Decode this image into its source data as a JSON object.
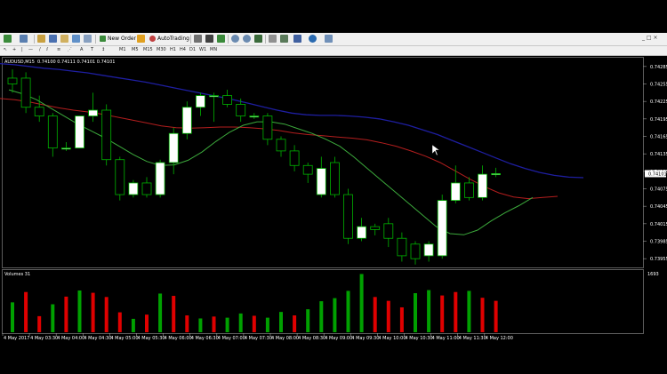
{
  "toolbar": {
    "new_order_label": "New Order",
    "autotrading_label": "AutoTrading",
    "timeframes": [
      "M1",
      "M5",
      "M15",
      "M30",
      "H1",
      "H4",
      "D1",
      "W1",
      "MN"
    ],
    "window_controls": "_ □ ×"
  },
  "chart_data": {
    "type": "candlestick",
    "symbol_label": "AUDUSD,M15",
    "ohlc_label": "0.74100 0.74111 0.74101 0.74101",
    "volume_label": "Volumes 31",
    "volume_top_label": "1693",
    "price_ticks": [
      "0.74285",
      "0.74255",
      "0.74225",
      "0.74195",
      "0.74165",
      "0.74135",
      "0.74105",
      "0.74075",
      "0.74045",
      "0.74015",
      "0.73985",
      "0.73955"
    ],
    "current_price": "0.74101",
    "ylim": [
      0.7394,
      0.743
    ],
    "time_labels": [
      "4 May 2017",
      "4 May 03:30",
      "4 May 04:00",
      "4 May 04:30",
      "4 May 05:00",
      "4 May 05:30",
      "4 May 06:00",
      "4 May 06:30",
      "4 May 07:00",
      "4 May 07:30",
      "4 May 08:00",
      "4 May 08:30",
      "4 May 09:00",
      "4 May 09:30",
      "4 May 10:00",
      "4 May 10:30",
      "4 May 11:00",
      "4 May 11:30",
      "4 May 12:00"
    ],
    "candles": [
      {
        "o": 0.74265,
        "h": 0.7428,
        "l": 0.7424,
        "c": 0.74255
      },
      {
        "o": 0.74265,
        "h": 0.74275,
        "l": 0.74205,
        "c": 0.74215
      },
      {
        "o": 0.74215,
        "h": 0.74235,
        "l": 0.7419,
        "c": 0.742
      },
      {
        "o": 0.742,
        "h": 0.74205,
        "l": 0.7413,
        "c": 0.74145
      },
      {
        "o": 0.74145,
        "h": 0.74155,
        "l": 0.7414,
        "c": 0.74145
      },
      {
        "o": 0.74145,
        "h": 0.742,
        "l": 0.74145,
        "c": 0.742
      },
      {
        "o": 0.742,
        "h": 0.7424,
        "l": 0.7419,
        "c": 0.7421
      },
      {
        "o": 0.7421,
        "h": 0.7422,
        "l": 0.74115,
        "c": 0.74125
      },
      {
        "o": 0.74125,
        "h": 0.7413,
        "l": 0.74055,
        "c": 0.74065
      },
      {
        "o": 0.74065,
        "h": 0.7409,
        "l": 0.7406,
        "c": 0.74085
      },
      {
        "o": 0.74085,
        "h": 0.74095,
        "l": 0.7406,
        "c": 0.74065
      },
      {
        "o": 0.74065,
        "h": 0.74125,
        "l": 0.7406,
        "c": 0.7412
      },
      {
        "o": 0.7412,
        "h": 0.7418,
        "l": 0.741,
        "c": 0.7417
      },
      {
        "o": 0.7417,
        "h": 0.74225,
        "l": 0.7416,
        "c": 0.74215
      },
      {
        "o": 0.74215,
        "h": 0.7424,
        "l": 0.742,
        "c": 0.74235
      },
      {
        "o": 0.74235,
        "h": 0.7424,
        "l": 0.7419,
        "c": 0.74235
      },
      {
        "o": 0.74235,
        "h": 0.74245,
        "l": 0.74215,
        "c": 0.7422
      },
      {
        "o": 0.7422,
        "h": 0.7423,
        "l": 0.7419,
        "c": 0.742
      },
      {
        "o": 0.742,
        "h": 0.74205,
        "l": 0.74195,
        "c": 0.742
      },
      {
        "o": 0.742,
        "h": 0.74205,
        "l": 0.7415,
        "c": 0.7416
      },
      {
        "o": 0.7416,
        "h": 0.74165,
        "l": 0.7413,
        "c": 0.7414
      },
      {
        "o": 0.7414,
        "h": 0.7415,
        "l": 0.74105,
        "c": 0.74115
      },
      {
        "o": 0.74115,
        "h": 0.7412,
        "l": 0.74085,
        "c": 0.741
      },
      {
        "o": 0.74065,
        "h": 0.7413,
        "l": 0.7406,
        "c": 0.7411
      },
      {
        "o": 0.7412,
        "h": 0.7413,
        "l": 0.7406,
        "c": 0.74065
      },
      {
        "o": 0.74065,
        "h": 0.74075,
        "l": 0.7398,
        "c": 0.7399
      },
      {
        "o": 0.7399,
        "h": 0.74025,
        "l": 0.73985,
        "c": 0.7401
      },
      {
        "o": 0.7401,
        "h": 0.74015,
        "l": 0.73995,
        "c": 0.74005
      },
      {
        "o": 0.74015,
        "h": 0.74025,
        "l": 0.73975,
        "c": 0.7399
      },
      {
        "o": 0.7399,
        "h": 0.74,
        "l": 0.7395,
        "c": 0.7396
      },
      {
        "o": 0.7398,
        "h": 0.73985,
        "l": 0.73945,
        "c": 0.73955
      },
      {
        "o": 0.7396,
        "h": 0.73985,
        "l": 0.7395,
        "c": 0.7398
      },
      {
        "o": 0.7396,
        "h": 0.74065,
        "l": 0.73955,
        "c": 0.74055
      },
      {
        "o": 0.74055,
        "h": 0.74115,
        "l": 0.7405,
        "c": 0.74085
      },
      {
        "o": 0.74085,
        "h": 0.74095,
        "l": 0.74055,
        "c": 0.7406
      },
      {
        "o": 0.7406,
        "h": 0.74115,
        "l": 0.74055,
        "c": 0.741
      },
      {
        "o": 0.741,
        "h": 0.74111,
        "l": 0.74095,
        "c": 0.74101
      }
    ],
    "volumes": [
      {
        "v": 780,
        "dir": "up"
      },
      {
        "v": 1050,
        "dir": "down"
      },
      {
        "v": 420,
        "dir": "down"
      },
      {
        "v": 730,
        "dir": "up"
      },
      {
        "v": 930,
        "dir": "down"
      },
      {
        "v": 1090,
        "dir": "up"
      },
      {
        "v": 1030,
        "dir": "down"
      },
      {
        "v": 920,
        "dir": "down"
      },
      {
        "v": 520,
        "dir": "down"
      },
      {
        "v": 350,
        "dir": "up"
      },
      {
        "v": 460,
        "dir": "down"
      },
      {
        "v": 1010,
        "dir": "up"
      },
      {
        "v": 950,
        "dir": "down"
      },
      {
        "v": 440,
        "dir": "down"
      },
      {
        "v": 360,
        "dir": "up"
      },
      {
        "v": 410,
        "dir": "down"
      },
      {
        "v": 380,
        "dir": "up"
      },
      {
        "v": 490,
        "dir": "up"
      },
      {
        "v": 430,
        "dir": "down"
      },
      {
        "v": 380,
        "dir": "up"
      },
      {
        "v": 530,
        "dir": "up"
      },
      {
        "v": 440,
        "dir": "down"
      },
      {
        "v": 600,
        "dir": "up"
      },
      {
        "v": 810,
        "dir": "up"
      },
      {
        "v": 890,
        "dir": "up"
      },
      {
        "v": 1080,
        "dir": "up"
      },
      {
        "v": 1520,
        "dir": "up"
      },
      {
        "v": 920,
        "dir": "down"
      },
      {
        "v": 820,
        "dir": "down"
      },
      {
        "v": 650,
        "dir": "down"
      },
      {
        "v": 1020,
        "dir": "up"
      },
      {
        "v": 1100,
        "dir": "up"
      },
      {
        "v": 960,
        "dir": "down"
      },
      {
        "v": 1050,
        "dir": "down"
      },
      {
        "v": 1080,
        "dir": "up"
      },
      {
        "v": 900,
        "dir": "down"
      },
      {
        "v": 820,
        "dir": "down"
      }
    ],
    "ma_blue": [
      0.7429,
      0.74288,
      0.74285,
      0.74282,
      0.7428,
      0.74277,
      0.74274,
      0.7427,
      0.74266,
      0.74262,
      0.74258,
      0.74253,
      0.74248,
      0.74243,
      0.74238,
      0.74233,
      0.74228,
      0.74222,
      0.74216,
      0.7421,
      0.74205,
      0.74202,
      0.74201,
      0.74201,
      0.742,
      0.74198,
      0.74195,
      0.7419,
      0.74184,
      0.74176,
      0.74168,
      0.74158,
      0.74148,
      0.74138,
      0.74128,
      0.74118,
      0.7411,
      0.74103,
      0.74098,
      0.74095,
      0.74094
    ],
    "ma_red": [
      0.7423,
      0.74228,
      0.74224,
      0.74219,
      0.74214,
      0.7421,
      0.74207,
      0.74203,
      0.74198,
      0.74193,
      0.74188,
      0.74183,
      0.7418,
      0.74179,
      0.7418,
      0.74181,
      0.74181,
      0.7418,
      0.74178,
      0.74175,
      0.74171,
      0.74168,
      0.74166,
      0.74164,
      0.74162,
      0.74159,
      0.74154,
      0.74148,
      0.7414,
      0.74131,
      0.7412,
      0.74106,
      0.74092,
      0.74079,
      0.74068,
      0.74061,
      0.74058,
      0.7406,
      0.74062
    ],
    "ma_green": [
      0.74245,
      0.74238,
      0.74228,
      0.74214,
      0.742,
      0.74186,
      0.74174,
      0.74162,
      0.74148,
      0.74134,
      0.74122,
      0.74115,
      0.74116,
      0.74124,
      0.74138,
      0.74156,
      0.74172,
      0.74184,
      0.7419,
      0.7419,
      0.74186,
      0.74178,
      0.7417,
      0.7416,
      0.74148,
      0.7413,
      0.7411,
      0.7409,
      0.7407,
      0.7405,
      0.7403,
      0.7401,
      0.73998,
      0.73996,
      0.74004,
      0.7402,
      0.74034,
      0.74046,
      0.7406
    ]
  },
  "colors": {
    "bull_body": "#ffffff",
    "candle_outline": "#00b400",
    "vol_up": "#00a000",
    "vol_down": "#e00000",
    "ma_blue": "#1e1ea0",
    "ma_red": "#b41e1e",
    "ma_green": "#3caa3c"
  }
}
